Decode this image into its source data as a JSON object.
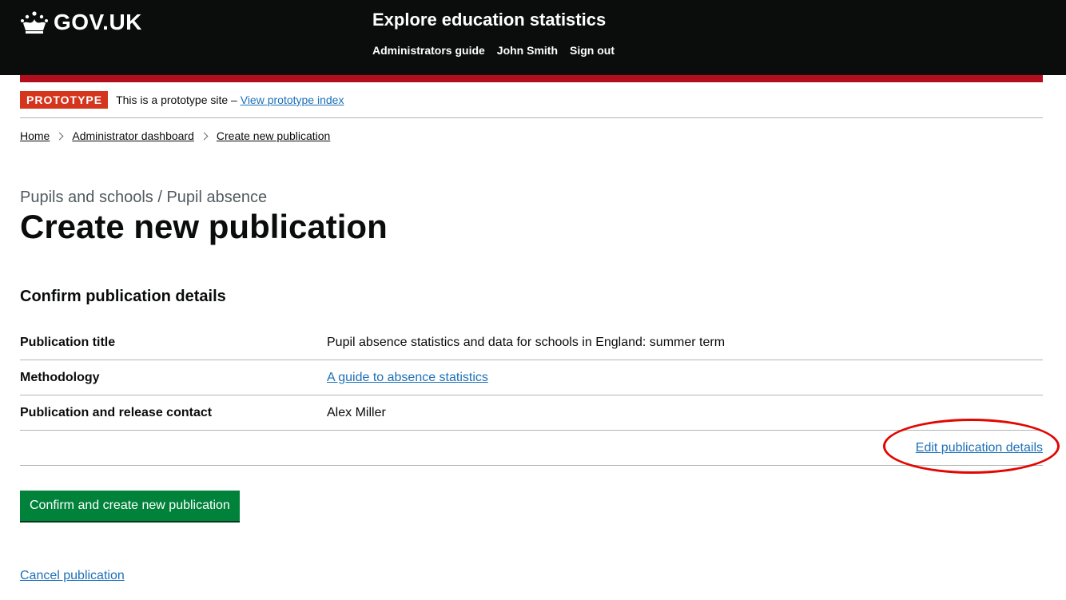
{
  "header": {
    "logo_text": "GOV.UK",
    "service_name": "Explore education statistics",
    "nav": [
      "Administrators guide",
      "John Smith",
      "Sign out"
    ],
    "icon": "crown-icon"
  },
  "phase_banner": {
    "tag": "PROTOTYPE",
    "text": "This is a prototype site –",
    "link": "View prototype index"
  },
  "breadcrumb": [
    "Home",
    "Administrator dashboard",
    "Create new publication"
  ],
  "page": {
    "caption": "Pupils and schools / Pupil absence",
    "title": "Create new publication",
    "section_heading": "Confirm publication details"
  },
  "summary": [
    {
      "key": "Publication title",
      "value": "Pupil absence statistics and data for schools in England: summer term"
    },
    {
      "key": "Methodology",
      "value": "A guide to absence statistics"
    },
    {
      "key": "Publication and release contact",
      "value": "Alex Miller"
    }
  ],
  "edit_link": "Edit publication details",
  "confirm_button": "Confirm and create new publication",
  "cancel_link": "Cancel publication",
  "colors": {
    "header_bg": "#0b0c0c",
    "red_bar": "#b10e1e",
    "phase_tag": "#d4351c",
    "link": "#1d70b8",
    "button": "#00823b",
    "annotation_circle": "#e10600"
  }
}
